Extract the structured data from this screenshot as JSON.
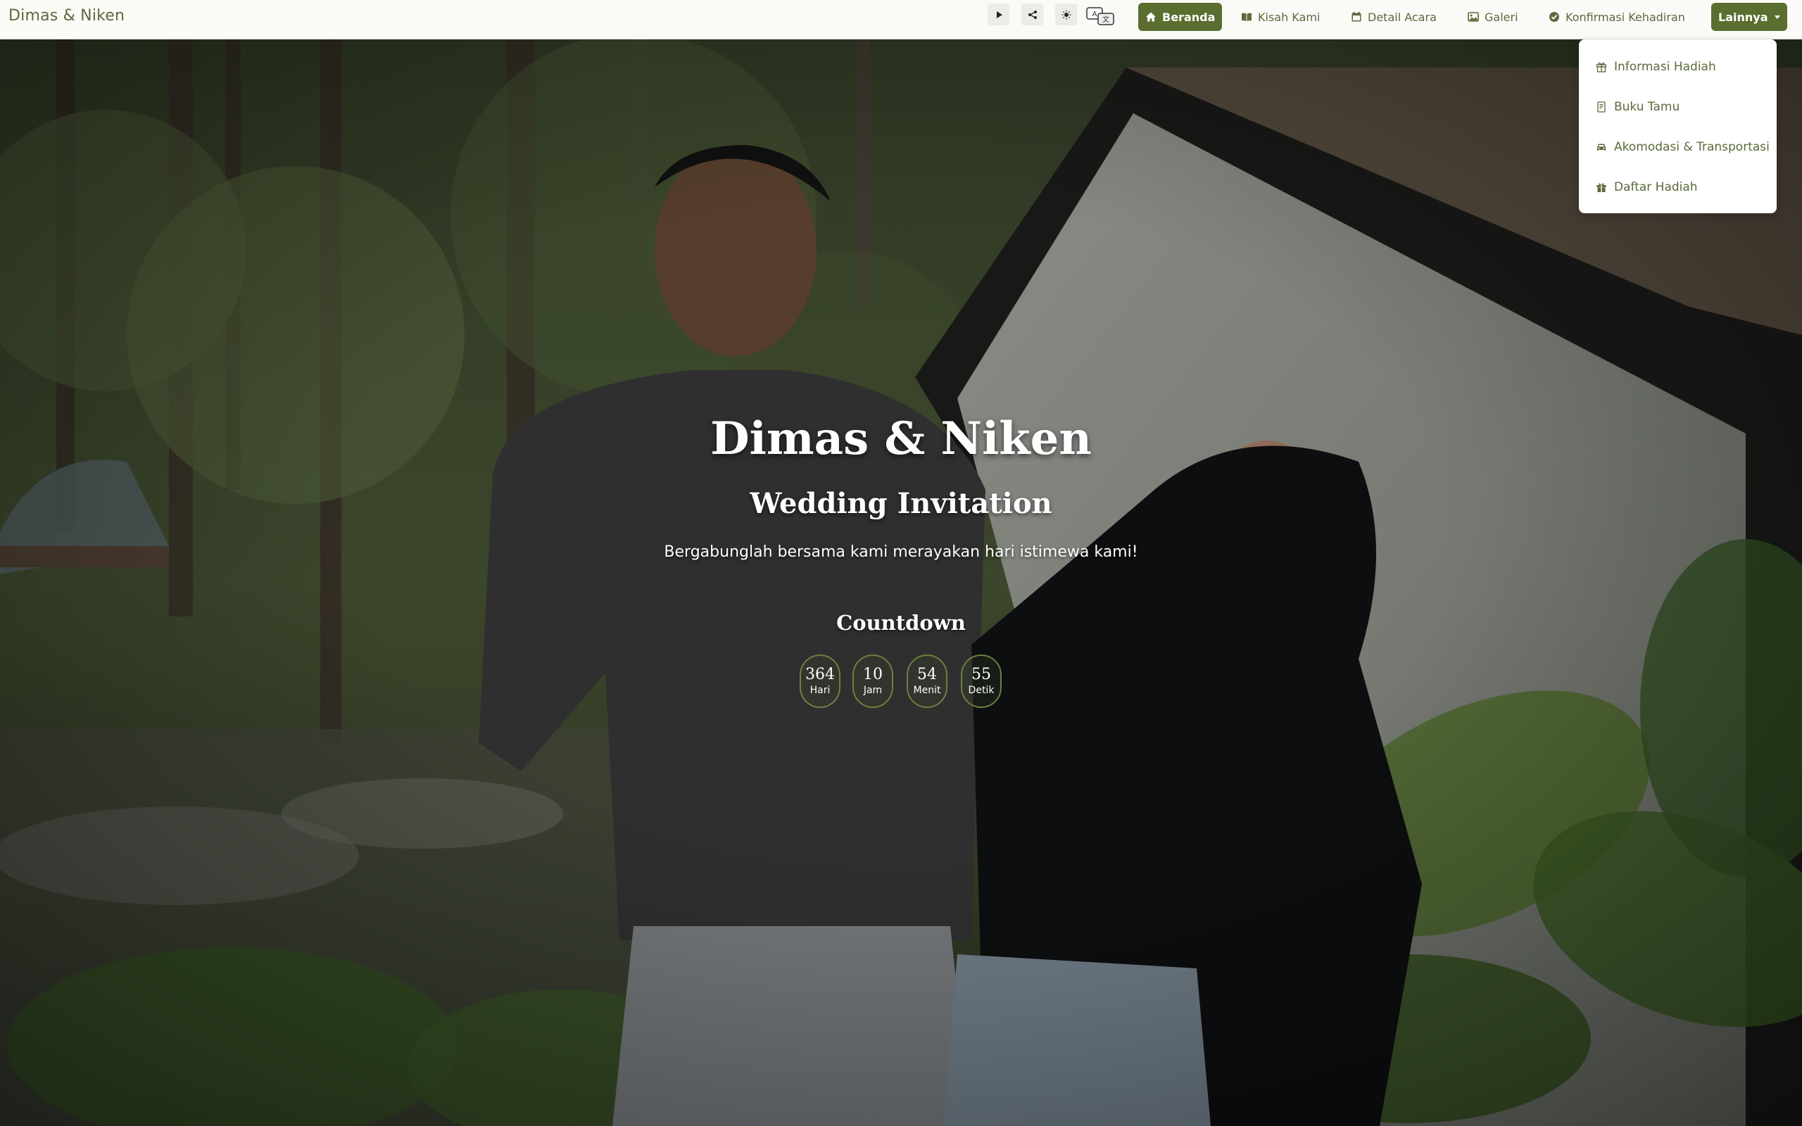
{
  "brand": "Dimas & Niken",
  "toolbar": {
    "play_icon": "play-icon",
    "share_icon": "share-icon",
    "theme_icon": "sun-icon",
    "language_icon": "translate-icon"
  },
  "nav": {
    "items": [
      {
        "label": "Beranda",
        "icon": "home-icon",
        "active": true
      },
      {
        "label": "Kisah Kami",
        "icon": "book-icon"
      },
      {
        "label": "Detail Acara",
        "icon": "calendar-icon"
      },
      {
        "label": "Galeri",
        "icon": "image-icon"
      },
      {
        "label": "Konfirmasi Kehadiran",
        "icon": "check-circle-icon"
      }
    ],
    "more_label": "Lainnya"
  },
  "dropdown": {
    "items": [
      {
        "label": "Informasi Hadiah",
        "icon": "gift-outline-icon"
      },
      {
        "label": "Buku Tamu",
        "icon": "journal-icon"
      },
      {
        "label": "Akomodasi & Transportasi",
        "icon": "car-icon"
      },
      {
        "label": "Daftar Hadiah",
        "icon": "gift-icon"
      }
    ]
  },
  "hero": {
    "title": "Dimas & Niken",
    "subtitle": "Wedding Invitation",
    "tagline": "Bergabunglah bersama kami merayakan hari istimewa kami!",
    "countdown_title": "Countdown",
    "countdown": [
      {
        "value": "364",
        "label": "Hari"
      },
      {
        "value": "10",
        "label": "Jam"
      },
      {
        "value": "54",
        "label": "Menit"
      },
      {
        "value": "55",
        "label": "Detik"
      }
    ]
  },
  "colors": {
    "accent": "#5a6e30",
    "accent_text": "#5b6a3c",
    "navbar_bg": "#fafaf7"
  }
}
